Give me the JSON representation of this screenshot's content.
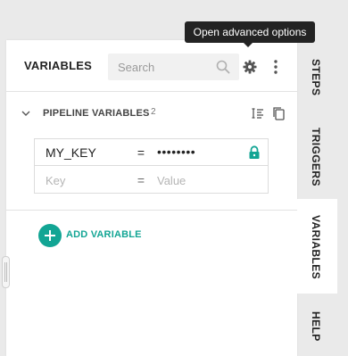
{
  "panel": {
    "title": "VARIABLES",
    "search_placeholder": "Search"
  },
  "tooltip": {
    "text": "Open advanced options"
  },
  "section": {
    "title": "PIPELINE VARIABLES",
    "count": "2"
  },
  "variables": [
    {
      "key": "MY_KEY",
      "eq": "=",
      "value": "••••••••",
      "secured": true
    }
  ],
  "new_row": {
    "key_placeholder": "Key",
    "eq": "=",
    "value_placeholder": "Value"
  },
  "add_button": {
    "label": "ADD VARIABLE"
  },
  "tabs": [
    {
      "label": "STEPS",
      "active": false
    },
    {
      "label": "TRIGGERS",
      "active": false
    },
    {
      "label": "VARIABLES",
      "active": true
    },
    {
      "label": "HELP",
      "active": false
    }
  ],
  "colors": {
    "accent": "#12a594",
    "tooltip_bg": "#232323",
    "background": "#eaeaea"
  },
  "icons": {
    "search": "search-icon",
    "settings": "gear-icon",
    "more": "kebab-menu-icon",
    "collapse": "chevron-down-icon",
    "bulk_edit": "bulk-edit-icon",
    "copy": "copy-icon",
    "lock": "lock-icon",
    "add": "plus-icon"
  }
}
